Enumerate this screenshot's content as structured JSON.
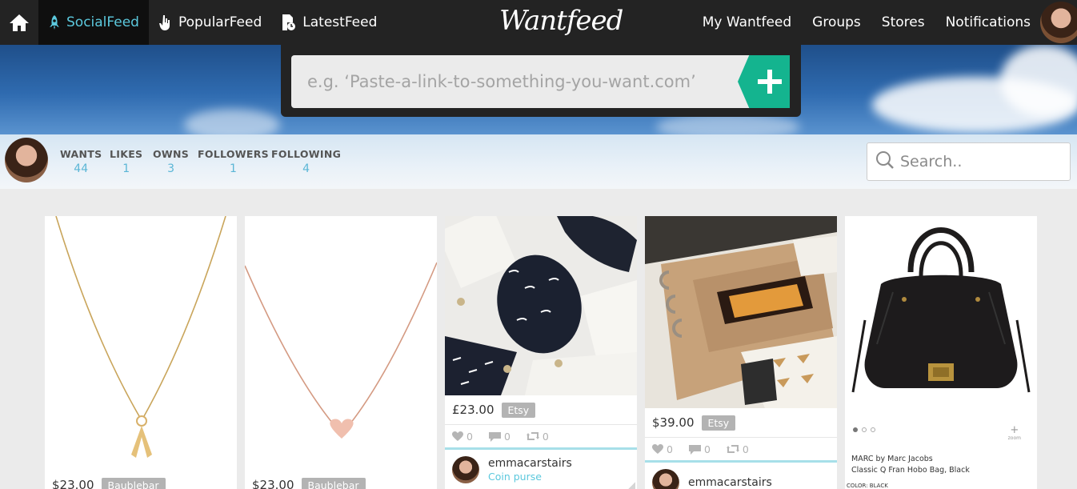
{
  "nav": {
    "tabs": [
      {
        "label": "SocialFeed",
        "icon": "rocket-icon"
      },
      {
        "label": "PopularFeed",
        "icon": "hand-icon"
      },
      {
        "label": "LatestFeed",
        "icon": "doc-clock-icon"
      }
    ],
    "logo": "Wantfeed",
    "links": [
      "My Wantfeed",
      "Groups",
      "Stores",
      "Notifications"
    ]
  },
  "link_input": {
    "placeholder": "e.g. ‘Paste-a-link-to-something-you-want.com’"
  },
  "profile": {
    "stats": [
      {
        "label": "WANTS",
        "value": "44"
      },
      {
        "label": "LIKES",
        "value": "1"
      },
      {
        "label": "OWNS",
        "value": "3"
      },
      {
        "label": "FOLLOWERS",
        "value": "1"
      },
      {
        "label": "FOLLOWING",
        "value": "4"
      }
    ]
  },
  "search": {
    "placeholder": "Search.."
  },
  "cards": [
    {
      "price": "$23.00",
      "store": "Baublebar"
    },
    {
      "price": "$23.00",
      "store": "Baublebar"
    },
    {
      "price": "£23.00",
      "store": "Etsy",
      "likes": "0",
      "comments": "0",
      "reposts": "0",
      "user": "emmacarstairs",
      "item": "Coin purse"
    },
    {
      "price": "$39.00",
      "store": "Etsy",
      "likes": "0",
      "comments": "0",
      "reposts": "0",
      "user": "emmacarstairs"
    },
    {
      "brand": "MARC by Marc Jacobs",
      "product": "Classic Q Fran Hobo Bag, Black",
      "color_label": "COLOR: BLACK",
      "zoom": "zoom"
    }
  ],
  "colors": {
    "accent": "#5bc8dd",
    "add_button": "#14b48f",
    "nav_bg": "#232323"
  }
}
